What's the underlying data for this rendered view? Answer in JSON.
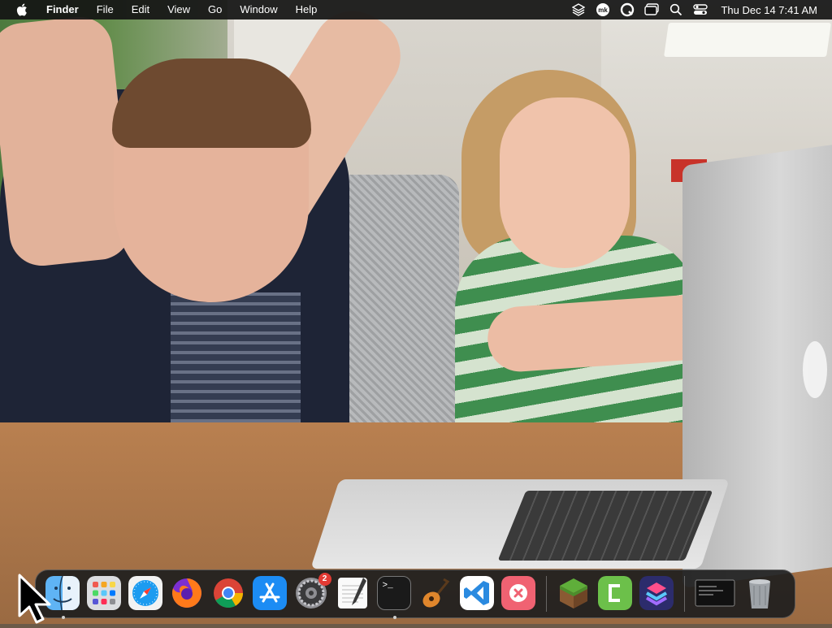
{
  "menubar": {
    "app_name": "Finder",
    "menus": [
      "File",
      "Edit",
      "View",
      "Go",
      "Window",
      "Help"
    ],
    "status_icons": [
      "layers-icon",
      "mk-icon",
      "search-circle-icon",
      "window-icon",
      "magnifier-icon",
      "control-center-icon"
    ],
    "clock": "Thu Dec 14  7:41 AM"
  },
  "dock": {
    "apps": [
      {
        "name": "Finder",
        "icon": "finder-icon",
        "running": true
      },
      {
        "name": "Launchpad",
        "icon": "launchpad-icon",
        "running": false
      },
      {
        "name": "Safari",
        "icon": "safari-icon",
        "running": false
      },
      {
        "name": "Firefox",
        "icon": "firefox-icon",
        "running": false
      },
      {
        "name": "Google Chrome",
        "icon": "chrome-icon",
        "running": false
      },
      {
        "name": "App Store",
        "icon": "app-store-icon",
        "running": false
      },
      {
        "name": "System Settings",
        "icon": "settings-icon",
        "running": false,
        "badge": "2"
      },
      {
        "name": "TextEdit",
        "icon": "textedit-icon",
        "running": false
      },
      {
        "name": "Terminal",
        "icon": "terminal-icon",
        "running": true
      },
      {
        "name": "GarageBand",
        "icon": "garageband-icon",
        "running": false
      },
      {
        "name": "Visual Studio Code",
        "icon": "vscode-icon",
        "running": false
      },
      {
        "name": "App Cleaner",
        "icon": "cleaner-icon",
        "running": false
      },
      {
        "name": "Minecraft",
        "icon": "minecraft-icon",
        "running": false
      },
      {
        "name": "Camtasia",
        "icon": "camtasia-icon",
        "running": false
      },
      {
        "name": "Shortcuts",
        "icon": "shortcuts-icon",
        "running": false
      },
      {
        "name": "Terminal Window",
        "icon": "window-preview-icon",
        "running": false
      },
      {
        "name": "Trash",
        "icon": "trash-icon",
        "running": false
      }
    ],
    "settings_badge": "2",
    "terminal_prompt": ">_"
  },
  "colors": {
    "menubar_bg": "#141414",
    "dock_bg": "#1e1e1e",
    "badge": "#e23a33",
    "vscode_blue": "#2a8ae0",
    "appstore_blue": "#1c8cf4"
  }
}
